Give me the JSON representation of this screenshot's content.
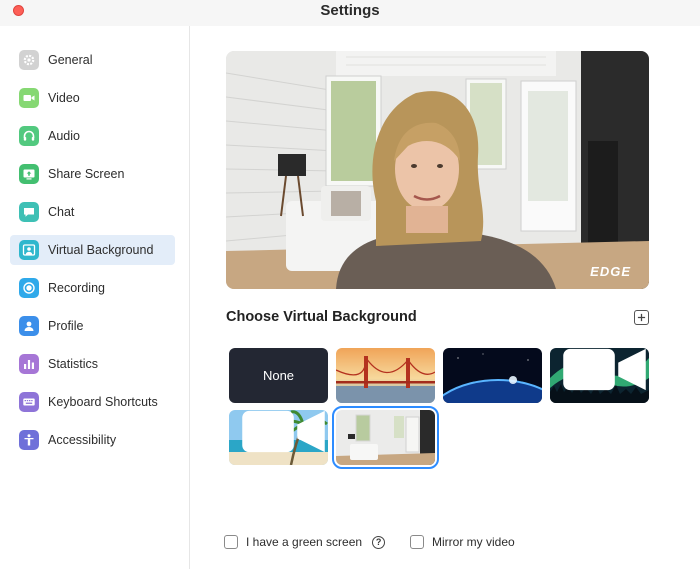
{
  "window": {
    "title": "Settings"
  },
  "sidebar": {
    "items": [
      {
        "label": "General",
        "icon": "gear-icon",
        "color": "#c9c9c9",
        "active": false
      },
      {
        "label": "Video",
        "icon": "video-camera-icon",
        "color": "#7fd46b",
        "active": false
      },
      {
        "label": "Audio",
        "icon": "headphones-icon",
        "color": "#4ec77d",
        "active": false
      },
      {
        "label": "Share Screen",
        "icon": "share-screen-icon",
        "color": "#3fbd6e",
        "active": false
      },
      {
        "label": "Chat",
        "icon": "chat-bubble-icon",
        "color": "#3cbfb3",
        "active": false
      },
      {
        "label": "Virtual Background",
        "icon": "virtual-background-icon",
        "color": "#2fb8cc",
        "active": true
      },
      {
        "label": "Recording",
        "icon": "record-icon",
        "color": "#2fa8e8",
        "active": false
      },
      {
        "label": "Profile",
        "icon": "person-icon",
        "color": "#3b8fe8",
        "active": false
      },
      {
        "label": "Statistics",
        "icon": "bar-chart-icon",
        "color": "#a574d4",
        "active": false
      },
      {
        "label": "Keyboard Shortcuts",
        "icon": "keyboard-icon",
        "color": "#8d73d6",
        "active": false
      },
      {
        "label": "Accessibility",
        "icon": "accessibility-icon",
        "color": "#6e6fd8",
        "active": false
      }
    ]
  },
  "main": {
    "preview_watermark": "EDGE",
    "section_title": "Choose Virtual Background",
    "backgrounds": [
      {
        "label": "None",
        "kind": "none",
        "selected": false
      },
      {
        "label": "",
        "kind": "golden-gate",
        "selected": false
      },
      {
        "label": "",
        "kind": "earth-space",
        "selected": false
      },
      {
        "label": "",
        "kind": "aurora",
        "selected": false,
        "video": true
      },
      {
        "label": "",
        "kind": "beach",
        "selected": false,
        "video": true
      },
      {
        "label": "",
        "kind": "room",
        "selected": true
      }
    ],
    "green_screen_label": "I have a green screen",
    "green_screen_checked": false,
    "mirror_label": "Mirror my video",
    "mirror_checked": false,
    "accent_color": "#2d8cff"
  }
}
